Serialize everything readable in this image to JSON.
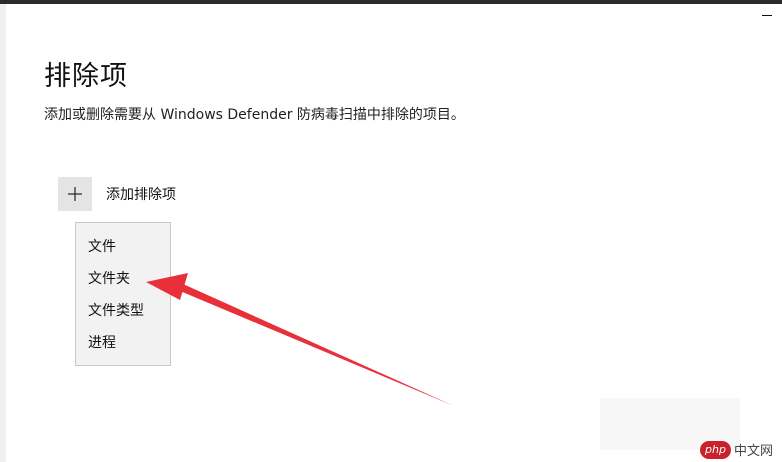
{
  "page": {
    "title": "排除项",
    "description": "添加或删除需要从 Windows Defender 防病毒扫描中排除的项目。"
  },
  "add_exclusion": {
    "icon": "plus-icon",
    "label": "添加排除项"
  },
  "menu": {
    "items": [
      {
        "label": "文件"
      },
      {
        "label": "文件夹"
      },
      {
        "label": "文件类型"
      },
      {
        "label": "进程"
      }
    ]
  },
  "annotation": {
    "arrow_color": "#e8303a"
  },
  "watermark": {
    "badge": "php",
    "text": "中文网"
  }
}
